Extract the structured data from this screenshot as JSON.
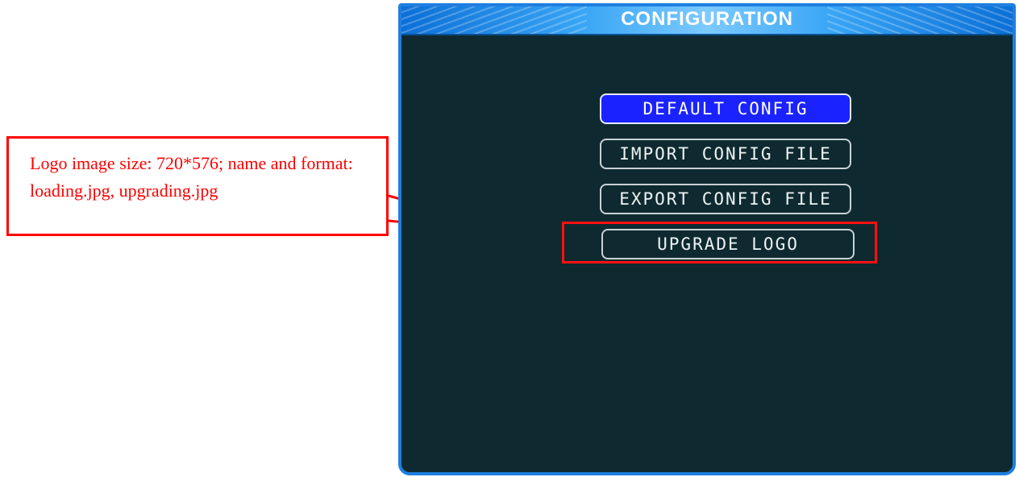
{
  "annotation": {
    "text": "Logo image size: 720*576; name and format: loading.jpg, upgrading.jpg",
    "color": "#ff0000"
  },
  "window": {
    "title": "CONFIGURATION",
    "background": "#0e2a30",
    "border_color": "#1d7fe0"
  },
  "menu": {
    "items": [
      {
        "label": "DEFAULT CONFIG",
        "selected": true
      },
      {
        "label": "IMPORT CONFIG FILE",
        "selected": false
      },
      {
        "label": "EXPORT CONFIG FILE",
        "selected": false
      },
      {
        "label": "UPGRADE LOGO",
        "selected": false
      }
    ],
    "selected_color": "#1a23ff"
  }
}
